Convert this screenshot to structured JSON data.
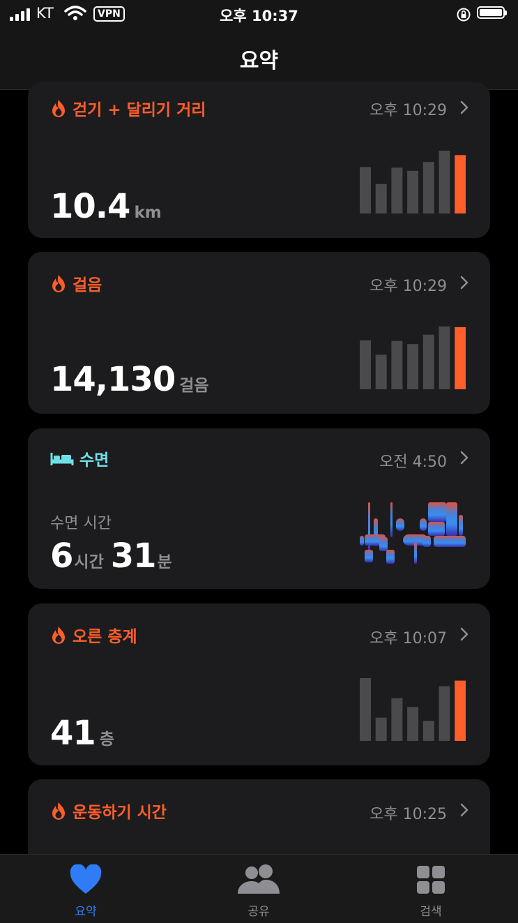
{
  "status": {
    "carrier": "KT",
    "vpn": "VPN",
    "time": "오후 10:37"
  },
  "nav": {
    "title": "요약"
  },
  "cards": [
    {
      "title": "걷기 + 달리기 거리",
      "time": "오후 10:29",
      "value": "10.4",
      "unit": "km",
      "bars": [
        0.74,
        0.47,
        0.73,
        0.68,
        0.82,
        1.0,
        0.93
      ]
    },
    {
      "title": "걸음",
      "time": "오후 10:29",
      "value": "14,130",
      "unit": "걸음",
      "bars": [
        0.78,
        0.55,
        0.77,
        0.72,
        0.87,
        1.0,
        0.99
      ]
    },
    {
      "title": "수면",
      "time": "오전 4:50",
      "subtitle": "수면 시간",
      "hours": "6",
      "hours_unit": "시간",
      "minutes": "31",
      "minutes_unit": "분"
    },
    {
      "title": "오른 층계",
      "time": "오후 10:07",
      "value": "41",
      "unit": "층",
      "bars": [
        1.0,
        0.37,
        0.68,
        0.54,
        0.32,
        0.87,
        0.96
      ]
    },
    {
      "title": "운동하기 시간",
      "time": "오후 10:25"
    }
  ],
  "tabs": [
    {
      "label": "요약",
      "icon": "heart-icon",
      "active": true
    },
    {
      "label": "공유",
      "icon": "people-icon",
      "active": false
    },
    {
      "label": "검색",
      "icon": "grid-icon",
      "active": false
    }
  ],
  "colors": {
    "accent_orange": "#ff5e2a",
    "sleep_cyan": "#6ee0e6",
    "tab_active": "#2f7cf6",
    "card_bg": "#1c1c1e"
  }
}
